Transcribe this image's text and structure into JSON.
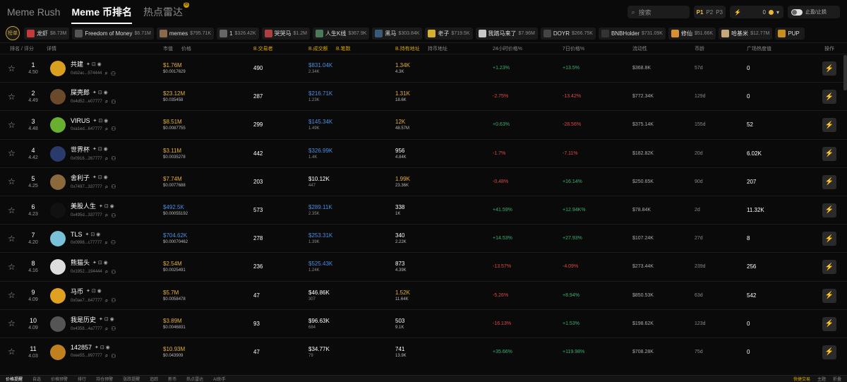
{
  "nav": {
    "tabs": [
      {
        "label": "Meme Rush",
        "active": false
      },
      {
        "label": "Meme 币排名",
        "active": true
      },
      {
        "label": "热点雷达",
        "active": false
      }
    ],
    "hot_badge": "热"
  },
  "search": {
    "placeholder": "搜索"
  },
  "pages": {
    "p1": "P1",
    "p2": "P2",
    "p3": "P3"
  },
  "rewards": {
    "value": "0"
  },
  "toggle": {
    "label": "止盈/止损"
  },
  "ticker": {
    "logo": "榜单",
    "items": [
      {
        "name": "龙虾",
        "value": "$8.73M",
        "color": "#c43a3a"
      },
      {
        "name": "Freedom of Money",
        "value": "$6.71M",
        "color": "#555"
      },
      {
        "name": "memes",
        "value": "$795.71K",
        "color": "#8a6a4a"
      },
      {
        "name": "1",
        "value": "$326.42K",
        "color": "#666"
      },
      {
        "name": "哭哭马",
        "value": "$1.2M",
        "color": "#b04040"
      },
      {
        "name": "人生K线",
        "value": "$367.9K",
        "color": "#4a7a5a"
      },
      {
        "name": "黑马",
        "value": "$303.84K",
        "color": "#3a5a7a"
      },
      {
        "name": "老子",
        "value": "$719.5K",
        "color": "#d8b030"
      },
      {
        "name": "我踏马来了",
        "value": "$7.96M",
        "color": "#c8c8c8"
      },
      {
        "name": "DOYR",
        "value": "$266.75K",
        "color": "#444"
      },
      {
        "name": "BNBHolder",
        "value": "$731.09K",
        "color": "#333"
      },
      {
        "name": "修仙",
        "value": "$51.66K",
        "color": "#d89030"
      },
      {
        "name": "哈基米",
        "value": "$12.77M",
        "color": "#c8a878"
      },
      {
        "name": "PUP",
        "value": "",
        "color": "#c89020"
      }
    ]
  },
  "columns": {
    "rank": "排名 / 评分",
    "detail": "详情",
    "mcap": "市值",
    "price": "价格",
    "traders": "B.交易者",
    "volume": "B.成交额",
    "txns": "B.笔数",
    "holders": "B.持有地址",
    "holders_all": "持币地址",
    "change24": "24小时价格%",
    "change7d": "7日价格%",
    "liquidity": "流动性",
    "age": "币龄",
    "heat": "广场热度值",
    "action": "操作"
  },
  "rows": [
    {
      "rank": "1",
      "score": "4.50",
      "name": "共建",
      "addr": "0xb2ac...574444",
      "avatar": "#d9a020",
      "mcap": "$1.76M",
      "price": "$0.0017629",
      "traders": "490",
      "volume": "$831.04K",
      "txns": "2.34K",
      "holders": "1.34K",
      "holders_sub": "4.3K",
      "ch24": "+1.23%",
      "ch24c": "green",
      "ch7": "+13.5%",
      "ch7c": "green",
      "liq": "$368.8K",
      "age": "57d",
      "heat": "0",
      "mcapc": "yellow",
      "volc": "blue",
      "holc": "yellow"
    },
    {
      "rank": "2",
      "score": "4.49",
      "name": "屎壳郎",
      "addr": "0x4d52...e07777",
      "avatar": "#6a4a2a",
      "mcap": "$23.12M",
      "price": "$0.035458",
      "traders": "287",
      "volume": "$216.71K",
      "txns": "1.23K",
      "holders": "1.31K",
      "holders_sub": "18.6K",
      "ch24": "-2.75%",
      "ch24c": "red",
      "ch7": "-13.42%",
      "ch7c": "red",
      "liq": "$772.34K",
      "age": "129d",
      "heat": "0",
      "mcapc": "yellow",
      "volc": "blue",
      "holc": "yellow"
    },
    {
      "rank": "3",
      "score": "4.48",
      "name": "VIRUS",
      "addr": "0xa1ed...647777",
      "avatar": "#6ab030",
      "mcap": "$8.51M",
      "price": "$0.0087755",
      "traders": "299",
      "volume": "$145.34K",
      "txns": "1.49K",
      "holders": "12K",
      "holders_sub": "48.57M",
      "ch24": "+0.63%",
      "ch24c": "green",
      "ch7": "-28.56%",
      "ch7c": "red",
      "liq": "$375.14K",
      "age": "155d",
      "heat": "52",
      "mcapc": "yellow",
      "volc": "blue",
      "holc": "yellow"
    },
    {
      "rank": "4",
      "score": "4.42",
      "name": "世界杯",
      "addr": "0x0916...267777",
      "avatar": "#2a3a6a",
      "mcap": "$3.11M",
      "price": "$0.0035278",
      "traders": "442",
      "volume": "$326.99K",
      "txns": "1.4K",
      "holders": "956",
      "holders_sub": "4.84K",
      "ch24": "-1.7%",
      "ch24c": "red",
      "ch7": "-7.11%",
      "ch7c": "red",
      "liq": "$182.82K",
      "age": "20d",
      "heat": "6.02K",
      "mcapc": "yellow",
      "volc": "blue",
      "holc": "white"
    },
    {
      "rank": "5",
      "score": "4.25",
      "name": "舍利子",
      "addr": "0x7497...337777",
      "avatar": "#8a6a3a",
      "mcap": "$7.74M",
      "price": "$0.0077688",
      "traders": "203",
      "volume": "$10.12K",
      "txns": "447",
      "holders": "1.99K",
      "holders_sub": "23.36K",
      "ch24": "-0.48%",
      "ch24c": "red",
      "ch7": "+16.14%",
      "ch7c": "green",
      "liq": "$250.65K",
      "age": "90d",
      "heat": "207",
      "mcapc": "yellow",
      "volc": "white",
      "holc": "yellow"
    },
    {
      "rank": "6",
      "score": "4.23",
      "name": "美股人生",
      "addr": "0x495d...337777",
      "avatar": "#111",
      "mcap": "$492.5K",
      "price": "$0.00055192",
      "traders": "573",
      "volume": "$289.11K",
      "txns": "2.35K",
      "holders": "338",
      "holders_sub": "1K",
      "ch24": "+41.59%",
      "ch24c": "green",
      "ch7": "+12.94K%",
      "ch7c": "green",
      "liq": "$78.84K",
      "age": "2d",
      "heat": "11.32K",
      "mcapc": "blue",
      "volc": "blue",
      "holc": "white"
    },
    {
      "rank": "7",
      "score": "4.20",
      "name": "TLS",
      "addr": "0x0998...c77777",
      "avatar": "#7ac0d8",
      "mcap": "$704.62K",
      "price": "$0.00070462",
      "traders": "278",
      "volume": "$253.31K",
      "txns": "1.39K",
      "holders": "340",
      "holders_sub": "2.22K",
      "ch24": "+14.53%",
      "ch24c": "green",
      "ch7": "+27.93%",
      "ch7c": "green",
      "liq": "$107.24K",
      "age": "27d",
      "heat": "8",
      "mcapc": "blue",
      "volc": "blue",
      "holc": "white"
    },
    {
      "rank": "8",
      "score": "4.16",
      "name": "熊猫头",
      "addr": "0x1952...194444",
      "avatar": "#ddd",
      "mcap": "$2.54M",
      "price": "$0.0025491",
      "traders": "236",
      "volume": "$525.43K",
      "txns": "1.24K",
      "holders": "873",
      "holders_sub": "4.39K",
      "ch24": "-13.57%",
      "ch24c": "red",
      "ch7": "-4.09%",
      "ch7c": "red",
      "liq": "$273.44K",
      "age": "239d",
      "heat": "256",
      "mcapc": "yellow",
      "volc": "blue",
      "holc": "white"
    },
    {
      "rank": "9",
      "score": "4.09",
      "name": "马币",
      "addr": "0x0ae7...647777",
      "avatar": "#e0a020",
      "mcap": "$5.7M",
      "price": "$0.0058478",
      "traders": "47",
      "volume": "$46.86K",
      "txns": "307",
      "holders": "1.52K",
      "holders_sub": "11.64K",
      "ch24": "-5.26%",
      "ch24c": "red",
      "ch7": "+8.94%",
      "ch7c": "green",
      "liq": "$850.53K",
      "age": "63d",
      "heat": "542",
      "mcapc": "yellow",
      "volc": "white",
      "holc": "yellow"
    },
    {
      "rank": "10",
      "score": "4.09",
      "name": "我是历史",
      "addr": "0x4358...4a7777",
      "avatar": "#555",
      "mcap": "$3.89M",
      "price": "$0.0046831",
      "traders": "93",
      "volume": "$96.63K",
      "txns": "684",
      "holders": "503",
      "holders_sub": "9.1K",
      "ch24": "-16.13%",
      "ch24c": "red",
      "ch7": "+1.53%",
      "ch7c": "green",
      "liq": "$198.62K",
      "age": "123d",
      "heat": "0",
      "mcapc": "yellow",
      "volc": "white",
      "holc": "white"
    },
    {
      "rank": "11",
      "score": "4.03",
      "name": "142857",
      "addr": "0xee55...897777",
      "avatar": "#c08020",
      "mcap": "$10.93M",
      "price": "$0.043909",
      "traders": "47",
      "volume": "$34.77K",
      "txns": "79",
      "holders": "741",
      "holders_sub": "13.9K",
      "ch24": "+35.66%",
      "ch24c": "green",
      "ch7": "+119.98%",
      "ch7c": "green",
      "liq": "$708.28K",
      "age": "75d",
      "heat": "0",
      "mcapc": "yellow",
      "volc": "white",
      "holc": "white"
    }
  ],
  "bottom": {
    "items": [
      "价格提醒",
      "自选",
      "价格预警",
      "排行",
      "持仓预警",
      "涨跌提醒",
      "追踪",
      "新币",
      "热点雷达",
      "AI助手"
    ],
    "right": [
      "快捷交易",
      "主题",
      "折叠"
    ]
  }
}
